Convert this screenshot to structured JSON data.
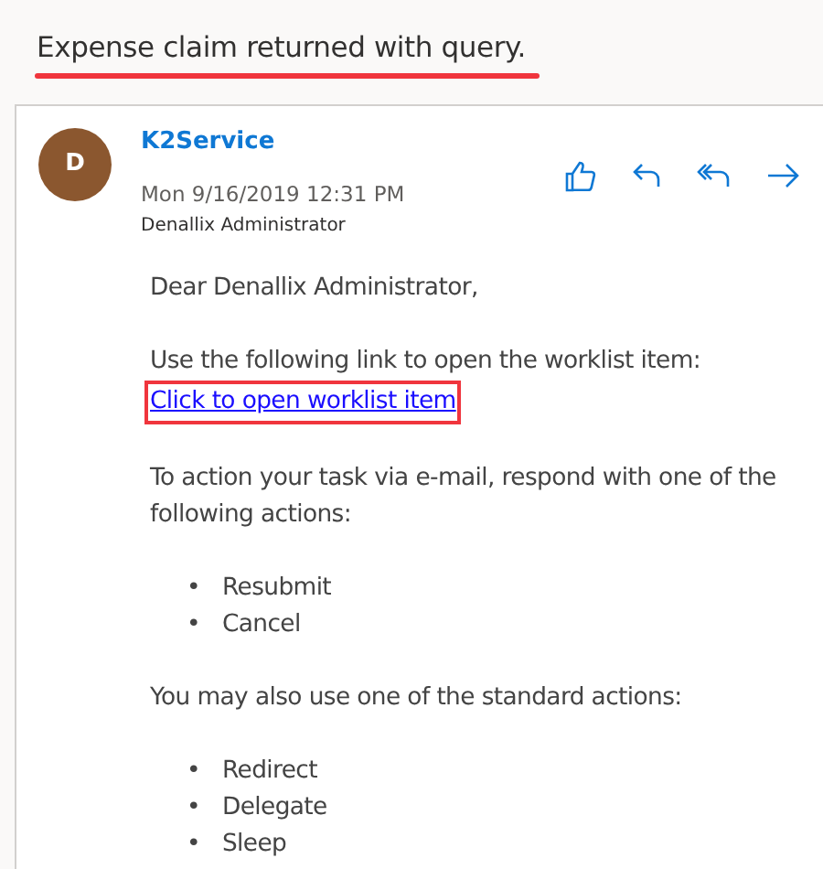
{
  "subject": "Expense claim returned with query.",
  "sender": {
    "initial": "D",
    "name": "K2Service"
  },
  "date": "Mon 9/16/2019 12:31 PM",
  "recipient": "Denallix Administrator",
  "body": [
    {
      "kind": "text",
      "text": "Dear Denallix Administrator,"
    },
    {
      "kind": "link",
      "text": "Use the following link to open the worklist item:",
      "link": "Click to open worklist item"
    },
    {
      "kind": "text",
      "text": "To action your task via e-mail, respond with one of the following actions:"
    },
    {
      "kind": "list",
      "marker": "•",
      "items": [
        "Resubmit",
        "Cancel"
      ]
    },
    {
      "kind": "text",
      "text": "You may also use one of the standard actions:"
    },
    {
      "kind": "list",
      "marker": "•",
      "items": [
        "Redirect",
        "Delegate",
        "Sleep"
      ]
    }
  ]
}
